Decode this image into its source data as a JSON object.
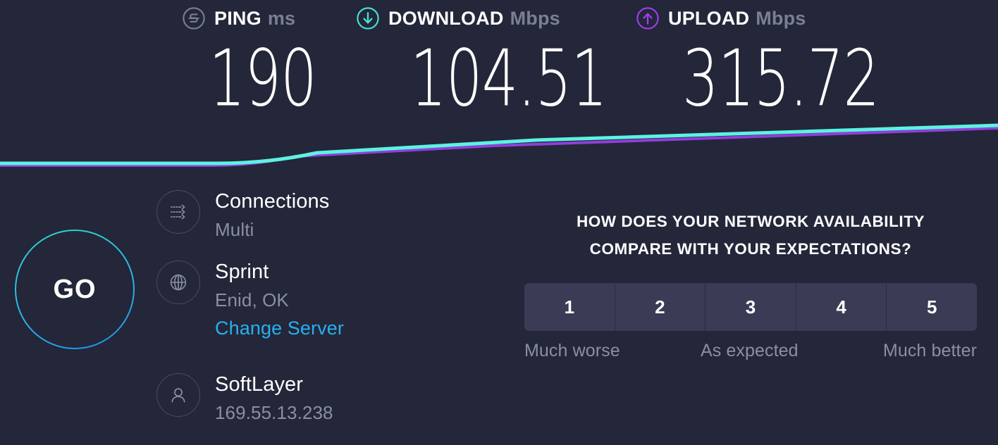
{
  "results": {
    "metrics": [
      {
        "icon": "ping-icon",
        "name": "PING",
        "unit": "ms",
        "value": "190",
        "accent": "#7b7f95"
      },
      {
        "icon": "download-icon",
        "name": "DOWNLOAD",
        "unit": "Mbps",
        "value": "104.51",
        "accent": "#44e5d8"
      },
      {
        "icon": "upload-icon",
        "name": "UPLOAD",
        "unit": "Mbps",
        "value": "315.72",
        "accent": "#a03df0"
      }
    ]
  },
  "graph": {
    "download_color": "#5cf2e2",
    "upload_color": "#8f3fd9"
  },
  "go_button": {
    "label": "GO"
  },
  "info": {
    "connections": {
      "icon": "multi-connections-icon",
      "title": "Connections",
      "value": "Multi"
    },
    "server": {
      "icon": "globe-icon",
      "title": "Sprint",
      "location": "Enid, OK",
      "change_link": "Change Server"
    },
    "isp": {
      "icon": "person-icon",
      "title": "SoftLayer",
      "ip": "169.55.13.238"
    }
  },
  "survey": {
    "question_line1": "HOW DOES YOUR NETWORK AVAILABILITY",
    "question_line2": "COMPARE WITH YOUR EXPECTATIONS?",
    "ratings": [
      "1",
      "2",
      "3",
      "4",
      "5"
    ],
    "scale_low": "Much worse",
    "scale_mid": "As expected",
    "scale_high": "Much better"
  },
  "colors": {
    "background": "#242639",
    "button_face": "#393c54",
    "muted_text": "#8b8fa4",
    "link": "#27b0f0"
  }
}
